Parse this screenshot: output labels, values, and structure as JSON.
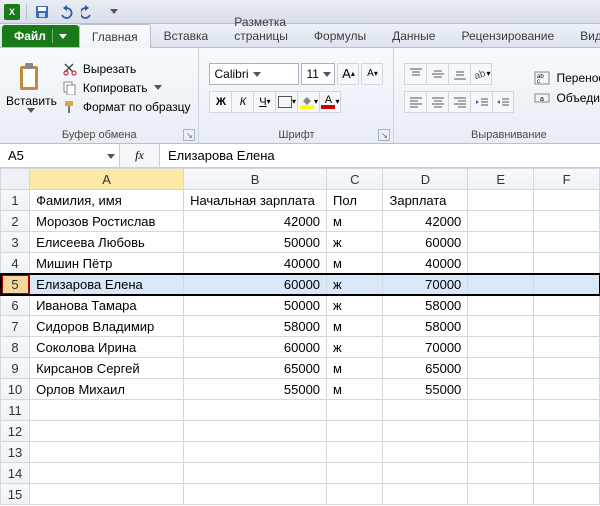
{
  "qat": {
    "app_label": "X"
  },
  "tabs": {
    "file": "Файл",
    "items": [
      "Главная",
      "Вставка",
      "Разметка страницы",
      "Формулы",
      "Данные",
      "Рецензирование",
      "Вид"
    ],
    "active_index": 0
  },
  "ribbon": {
    "clipboard": {
      "paste": "Вставить",
      "cut": "Вырезать",
      "copy": "Копировать",
      "format_painter": "Формат по образцу",
      "group_label": "Буфер обмена"
    },
    "font": {
      "name": "Calibri",
      "size": "11",
      "bold": "Ж",
      "italic": "К",
      "underline": "Ч",
      "grow": "A",
      "shrink": "A",
      "fill_letter": "A",
      "font_color_letter": "A",
      "group_label": "Шрифт"
    },
    "alignment": {
      "wrap": "Перенос т",
      "merge": "Объедини",
      "group_label": "Выравнивание"
    }
  },
  "namebox": {
    "ref": "A5"
  },
  "formula_bar": {
    "fx": "fx",
    "value": "Елизарова Елена"
  },
  "columns": [
    "A",
    "B",
    "C",
    "D",
    "E",
    "F"
  ],
  "headers": {
    "A": "Фамилия, имя",
    "B": "Начальная зарплата",
    "C": "Пол",
    "D": "Зарплата"
  },
  "rows": [
    {
      "n": 1,
      "A": "Фамилия, имя",
      "B": "Начальная зарплата",
      "C": "Пол",
      "D": "Зарплата",
      "is_header": true
    },
    {
      "n": 2,
      "A": "Морозов Ростислав",
      "B": 42000,
      "C": "м",
      "D": 42000
    },
    {
      "n": 3,
      "A": "Елисеева Любовь",
      "B": 50000,
      "C": "ж",
      "D": 60000
    },
    {
      "n": 4,
      "A": "Мишин Пётр",
      "B": 40000,
      "C": "м",
      "D": 40000
    },
    {
      "n": 5,
      "A": "Елизарова Елена",
      "B": 60000,
      "C": "ж",
      "D": 70000,
      "selected": true
    },
    {
      "n": 6,
      "A": "Иванова Тамара",
      "B": 50000,
      "C": "ж",
      "D": 58000
    },
    {
      "n": 7,
      "A": "Сидоров Владимир",
      "B": 58000,
      "C": "м",
      "D": 58000
    },
    {
      "n": 8,
      "A": "Соколова Ирина",
      "B": 60000,
      "C": "ж",
      "D": 70000
    },
    {
      "n": 9,
      "A": "Кирсанов Сергей",
      "B": 65000,
      "C": "м",
      "D": 65000
    },
    {
      "n": 10,
      "A": "Орлов Михаил",
      "B": 55000,
      "C": "м",
      "D": 55000
    },
    {
      "n": 11
    },
    {
      "n": 12
    },
    {
      "n": 13
    },
    {
      "n": 14
    },
    {
      "n": 15
    }
  ]
}
